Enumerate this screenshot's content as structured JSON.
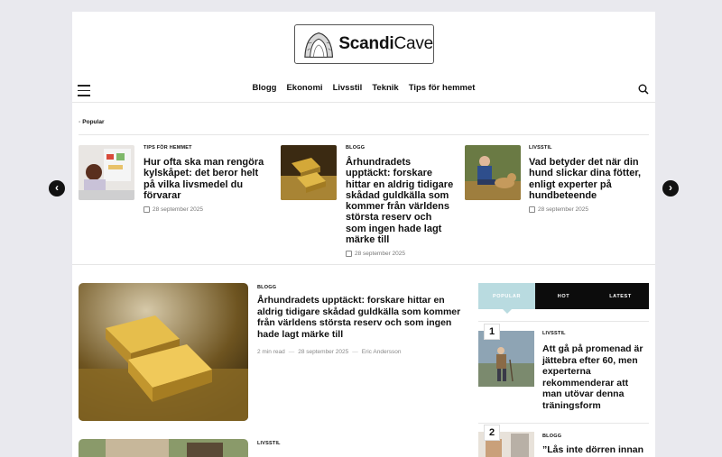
{
  "brand": {
    "name_bold": "Scandi",
    "name_regular": "Cave"
  },
  "nav": {
    "items": [
      "Blogg",
      "Ekonomi",
      "Livsstil",
      "Teknik",
      "Tips för hemmet"
    ]
  },
  "popular_label": "Popular",
  "carousel": [
    {
      "category": "TIPS FÖR HEMMET",
      "title": "Hur ofta ska man rengöra kylskåpet: det beror helt på vilka livsmedel du förvarar",
      "date": "28 september 2025"
    },
    {
      "category": "BLOGG",
      "title": "Århundradets upptäckt: forskare hittar en aldrig tidigare skådad guldkälla som kommer från världens största reserv och som ingen hade lagt märke till",
      "date": "28 september 2025"
    },
    {
      "category": "LIVSSTIL",
      "title": "Vad betyder det när din hund slickar dina fötter, enligt experter på hundbeteende",
      "date": "28 september 2025"
    }
  ],
  "featured": {
    "category": "BLOGG",
    "title": "Århundradets upptäckt: forskare hittar en aldrig tidigare skådad guldkälla som kommer från världens största reserv och som ingen hade lagt märke till",
    "read_time": "2 min read",
    "date": "28 september 2025",
    "author": "Eric Andersson"
  },
  "second": {
    "category": "LIVSSTIL"
  },
  "tabs": [
    "POPULAR",
    "HOT",
    "LATEST"
  ],
  "sidebar": [
    {
      "rank": "1",
      "category": "LIVSSTIL",
      "title": "Att gå på promenad är jättebra efter 60, men experterna rekommenderar att man utövar denna träningsform"
    },
    {
      "rank": "2",
      "category": "BLOGG",
      "title": "”Lås inte dörren innan"
    }
  ]
}
